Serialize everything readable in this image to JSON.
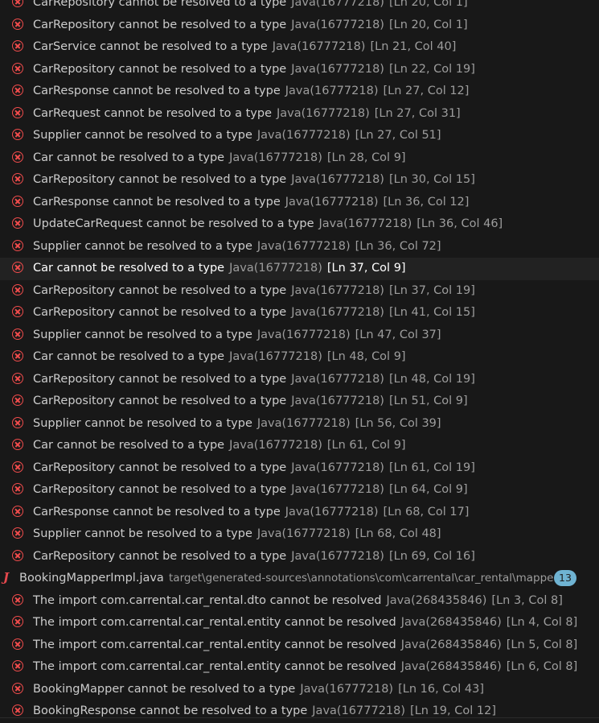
{
  "problems_before": [
    {
      "message": "CarRepository cannot be resolved to a type",
      "source": "Java(16777218)",
      "location": "[Ln 20, Col 1]"
    },
    {
      "message": "CarRepository cannot be resolved to a type",
      "source": "Java(16777218)",
      "location": "[Ln 20, Col 1]"
    },
    {
      "message": "CarService cannot be resolved to a type",
      "source": "Java(16777218)",
      "location": "[Ln 21, Col 40]"
    },
    {
      "message": "CarRepository cannot be resolved to a type",
      "source": "Java(16777218)",
      "location": "[Ln 22, Col 19]"
    },
    {
      "message": "CarResponse cannot be resolved to a type",
      "source": "Java(16777218)",
      "location": "[Ln 27, Col 12]"
    },
    {
      "message": "CarRequest cannot be resolved to a type",
      "source": "Java(16777218)",
      "location": "[Ln 27, Col 31]"
    },
    {
      "message": "Supplier cannot be resolved to a type",
      "source": "Java(16777218)",
      "location": "[Ln 27, Col 51]"
    },
    {
      "message": "Car cannot be resolved to a type",
      "source": "Java(16777218)",
      "location": "[Ln 28, Col 9]"
    },
    {
      "message": "CarRepository cannot be resolved to a type",
      "source": "Java(16777218)",
      "location": "[Ln 30, Col 15]"
    },
    {
      "message": "CarResponse cannot be resolved to a type",
      "source": "Java(16777218)",
      "location": "[Ln 36, Col 12]"
    },
    {
      "message": "UpdateCarRequest cannot be resolved to a type",
      "source": "Java(16777218)",
      "location": "[Ln 36, Col 46]"
    },
    {
      "message": "Supplier cannot be resolved to a type",
      "source": "Java(16777218)",
      "location": "[Ln 36, Col 72]"
    },
    {
      "message": "Car cannot be resolved to a type",
      "source": "Java(16777218)",
      "location": "[Ln 37, Col 9]",
      "selected": true
    },
    {
      "message": "CarRepository cannot be resolved to a type",
      "source": "Java(16777218)",
      "location": "[Ln 37, Col 19]"
    },
    {
      "message": "CarRepository cannot be resolved to a type",
      "source": "Java(16777218)",
      "location": "[Ln 41, Col 15]"
    },
    {
      "message": "Supplier cannot be resolved to a type",
      "source": "Java(16777218)",
      "location": "[Ln 47, Col 37]"
    },
    {
      "message": "Car cannot be resolved to a type",
      "source": "Java(16777218)",
      "location": "[Ln 48, Col 9]"
    },
    {
      "message": "CarRepository cannot be resolved to a type",
      "source": "Java(16777218)",
      "location": "[Ln 48, Col 19]"
    },
    {
      "message": "CarRepository cannot be resolved to a type",
      "source": "Java(16777218)",
      "location": "[Ln 51, Col 9]"
    },
    {
      "message": "Supplier cannot be resolved to a type",
      "source": "Java(16777218)",
      "location": "[Ln 56, Col 39]"
    },
    {
      "message": "Car cannot be resolved to a type",
      "source": "Java(16777218)",
      "location": "[Ln 61, Col 9]"
    },
    {
      "message": "CarRepository cannot be resolved to a type",
      "source": "Java(16777218)",
      "location": "[Ln 61, Col 19]"
    },
    {
      "message": "CarRepository cannot be resolved to a type",
      "source": "Java(16777218)",
      "location": "[Ln 64, Col 9]"
    },
    {
      "message": "CarResponse cannot be resolved to a type",
      "source": "Java(16777218)",
      "location": "[Ln 68, Col 17]"
    },
    {
      "message": "Supplier cannot be resolved to a type",
      "source": "Java(16777218)",
      "location": "[Ln 68, Col 48]"
    },
    {
      "message": "CarRepository cannot be resolved to a type",
      "source": "Java(16777218)",
      "location": "[Ln 69, Col 16]"
    }
  ],
  "file_group": {
    "icon": "java-file-icon",
    "name": "BookingMapperImpl.java",
    "path": "target\\generated-sources\\annotations\\com\\carrental\\car_rental\\mapper",
    "count": "13"
  },
  "problems_after": [
    {
      "message": "The import com.carrental.car_rental.dto cannot be resolved",
      "source": "Java(268435846)",
      "location": "[Ln 3, Col 8]"
    },
    {
      "message": "The import com.carrental.car_rental.entity cannot be resolved",
      "source": "Java(268435846)",
      "location": "[Ln 4, Col 8]"
    },
    {
      "message": "The import com.carrental.car_rental.entity cannot be resolved",
      "source": "Java(268435846)",
      "location": "[Ln 5, Col 8]"
    },
    {
      "message": "The import com.carrental.car_rental.entity cannot be resolved",
      "source": "Java(268435846)",
      "location": "[Ln 6, Col 8]"
    },
    {
      "message": "BookingMapper cannot be resolved to a type",
      "source": "Java(16777218)",
      "location": "[Ln 16, Col 43]"
    },
    {
      "message": "BookingResponse cannot be resolved to a type",
      "source": "Java(16777218)",
      "location": "[Ln 19, Col 12]"
    }
  ],
  "colors": {
    "background": "#181818",
    "error": "#f14c4c",
    "badge": "#6fb3d2",
    "java_icon": "#e5484d"
  }
}
